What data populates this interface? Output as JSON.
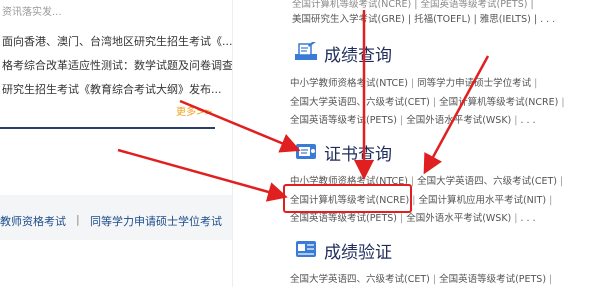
{
  "left": {
    "top_fragment": "资讯落实发...",
    "news": [
      "面向香港、澳门、台湾地区研究生招生考试《...",
      "格考综合改革适应性测试：数学试题及问卷调查",
      "研究生招生考试《教育综合考试大纲》发布..."
    ],
    "more_label": "更多>>",
    "bottom_links": [
      "教师资格考试",
      "同等学力申请硕士学位考试"
    ],
    "separator": "|"
  },
  "right": {
    "top_lines": [
      "全国计算机等级考试(NCRE)  |  全国英语等级考试(PETS)  |",
      "美国研究生入学考试(GRE)  |  托福(TOEFL)  |  雅思(IELTS)  |  . . ."
    ],
    "sections": [
      {
        "title": "成绩查询",
        "icon": "score-query-icon",
        "lines": [
          [
            "中小学教师资格考试(NTCE)",
            "同等学力申请硕士学位考试",
            ""
          ],
          [
            "全国大学英语四、六级考试(CET)",
            "全国计算机等级考试(NCRE)",
            ""
          ],
          [
            "全国英语等级考试(PETS)",
            "全国外语水平考试(WSK)",
            ". . ."
          ]
        ]
      },
      {
        "title": "证书查询",
        "icon": "certificate-query-icon",
        "lines": [
          [
            "中小学教师资格考试(NTCE)",
            "全国大学英语四、六级考试(CET)",
            ""
          ],
          [
            "全国计算机等级考试(NCRE)",
            "全国计算机应用水平考试(NIT)",
            ""
          ],
          [
            "全国英语等级考试(PETS)",
            "全国外语水平考试(WSK)",
            ". . ."
          ]
        ]
      },
      {
        "title": "成绩验证",
        "icon": "score-verify-icon",
        "lines": [
          [
            "全国大学英语四、六级考试(CET)",
            "全国英语等级考试(PETS)",
            ""
          ]
        ]
      }
    ]
  },
  "colors": {
    "title": "#1f2d5c",
    "link_blue": "#1d4c8c",
    "icon_blue": "#3a7bd5",
    "annotation_red": "#e02020",
    "more_orange": "#f0a020"
  }
}
